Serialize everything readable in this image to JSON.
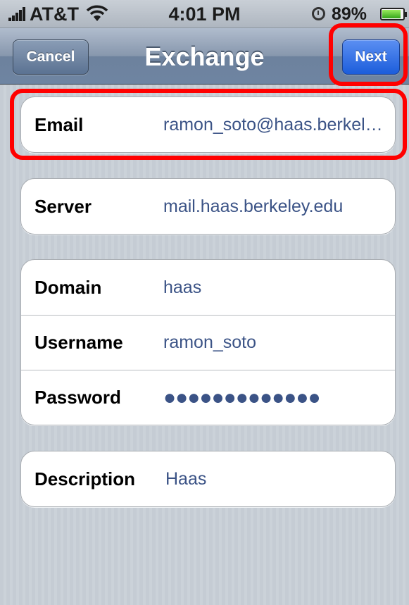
{
  "status_bar": {
    "carrier": "AT&T",
    "time": "4:01 PM",
    "battery_percent": "89%",
    "battery_level": 0.89,
    "icons": [
      "signal-bars",
      "wifi",
      "alarm-clock",
      "battery"
    ]
  },
  "nav": {
    "title": "Exchange",
    "cancel_label": "Cancel",
    "next_label": "Next"
  },
  "form": {
    "email": {
      "label": "Email",
      "value": "ramon_soto@haas.berkel…"
    },
    "server": {
      "label": "Server",
      "value": "mail.haas.berkeley.edu"
    },
    "domain": {
      "label": "Domain",
      "value": "haas"
    },
    "username": {
      "label": "Username",
      "value": "ramon_soto"
    },
    "password": {
      "label": "Password",
      "value": "●●●●●●●●●●●●●"
    },
    "description": {
      "label": "Description",
      "value": "Haas"
    }
  },
  "colors": {
    "highlight": "#ff0000",
    "value_text": "#3b5386",
    "next_button": "#1c5ddb"
  }
}
